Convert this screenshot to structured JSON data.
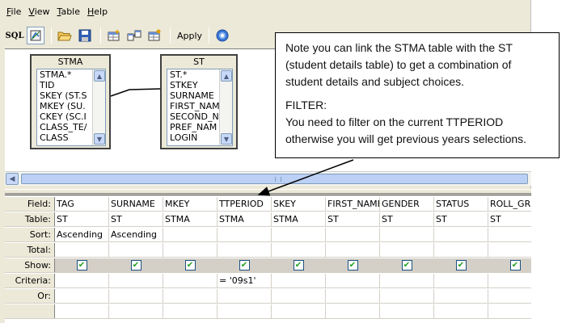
{
  "menu": [
    "File",
    "View",
    "Table",
    "Help"
  ],
  "toolbar": {
    "sql_label": "SQL",
    "apply_label": "Apply"
  },
  "tables": {
    "stma": {
      "title": "STMA",
      "fields": [
        "STMA.*",
        "TID",
        "SKEY (ST.S",
        "MKEY (SU.",
        "CKEY (SC.I",
        "CLASS_TE/",
        "CLASS"
      ]
    },
    "st": {
      "title": "ST",
      "fields": [
        "ST.*",
        "STKEY",
        "SURNAME",
        "FIRST_NAM",
        "SECOND_N",
        "PREF_NAM",
        "LOGIN"
      ]
    }
  },
  "grid": {
    "row_labels": {
      "field": "Field:",
      "table": "Table:",
      "sort": "Sort:",
      "total": "Total:",
      "show": "Show:",
      "criteria": "Criteria:",
      "or": "Or:"
    },
    "columns": [
      {
        "field": "TAG",
        "table": "ST",
        "sort": "Ascending",
        "criteria": "",
        "show": true
      },
      {
        "field": "SURNAME",
        "table": "ST",
        "sort": "Ascending",
        "criteria": "",
        "show": true
      },
      {
        "field": "MKEY",
        "table": "STMA",
        "sort": "",
        "criteria": "",
        "show": true
      },
      {
        "field": "TTPERIOD",
        "table": "STMA",
        "sort": "",
        "criteria": "= '09s1'",
        "show": true
      },
      {
        "field": "SKEY",
        "table": "STMA",
        "sort": "",
        "criteria": "",
        "show": true
      },
      {
        "field": "FIRST_NAME",
        "table": "ST",
        "sort": "",
        "criteria": "",
        "show": true
      },
      {
        "field": "GENDER",
        "table": "ST",
        "sort": "",
        "criteria": "",
        "show": true
      },
      {
        "field": "STATUS",
        "table": "ST",
        "sort": "",
        "criteria": "",
        "show": true
      },
      {
        "field": "ROLL_GR",
        "table": "ST",
        "sort": "",
        "criteria": "",
        "show": true
      }
    ]
  },
  "callout": {
    "note": "Note you can link the STMA table with the ST (student details table) to get a combination of student details and subject choices.",
    "filter_heading": "FILTER:",
    "filter_text": "You need to filter on the current TTPERIOD otherwise you will get previous years selections."
  },
  "colors": {
    "window_bg": "#ece9d8",
    "scroll_blue": "#c8d8f8",
    "check_green": "#21a121"
  }
}
